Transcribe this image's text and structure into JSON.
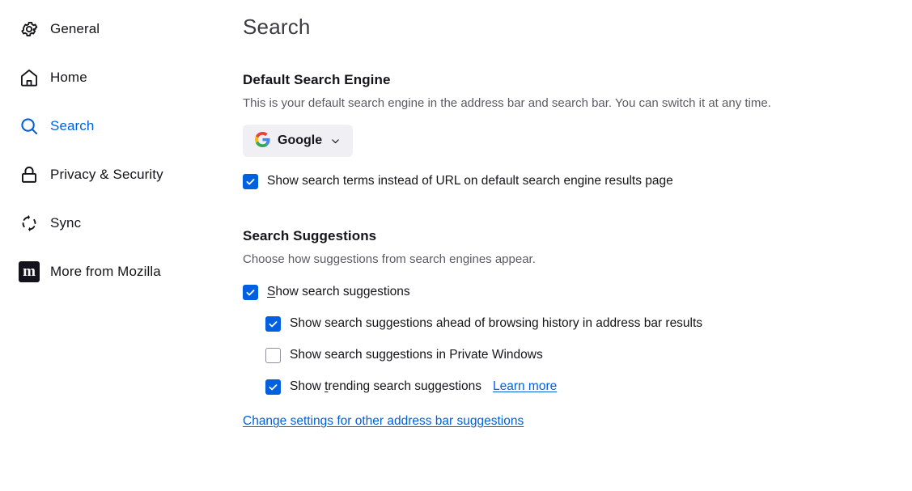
{
  "sidebar": {
    "items": [
      {
        "label": "General",
        "icon": "gear-icon",
        "active": false
      },
      {
        "label": "Home",
        "icon": "home-icon",
        "active": false
      },
      {
        "label": "Search",
        "icon": "search-icon",
        "active": true
      },
      {
        "label": "Privacy & Security",
        "icon": "lock-icon",
        "active": false
      },
      {
        "label": "Sync",
        "icon": "sync-icon",
        "active": false
      },
      {
        "label": "More from Mozilla",
        "icon": "mozilla-icon",
        "active": false
      }
    ]
  },
  "main": {
    "page_title": "Search",
    "default_engine": {
      "heading": "Default Search Engine",
      "description": "This is your default search engine in the address bar and search bar. You can switch it at any time.",
      "selected_engine": "Google",
      "engine_icon": "google-logo-icon",
      "chevron_icon": "chevron-down-icon",
      "show_terms_checkbox": {
        "label": "Show search terms instead of URL on default search engine results page",
        "checked": true
      }
    },
    "suggestions": {
      "heading": "Search Suggestions",
      "description": "Choose how suggestions from search engines appear.",
      "items": [
        {
          "label_prefix": "",
          "accesskey": "S",
          "label_suffix": "how search suggestions",
          "checked": true,
          "indent": false
        },
        {
          "label_prefix": "Show search suggestions ahead of browsing history in address bar results",
          "accesskey": "",
          "label_suffix": "",
          "checked": true,
          "indent": true
        },
        {
          "label_prefix": "Show search suggestions in Private Windows",
          "accesskey": "",
          "label_suffix": "",
          "checked": false,
          "indent": true
        },
        {
          "label_prefix": "Show ",
          "accesskey": "t",
          "label_suffix": "rending search suggestions",
          "checked": true,
          "indent": true,
          "link": "Learn more"
        }
      ],
      "other_suggestions_link": "Change settings for other address bar suggestions"
    }
  },
  "colors": {
    "accent": "#0060df",
    "active_nav": "#0061e0",
    "text": "#15141a",
    "muted_text": "#5b5b66",
    "dropdown_bg": "#f0f0f4",
    "checkbox_border": "#8f8f9d"
  }
}
